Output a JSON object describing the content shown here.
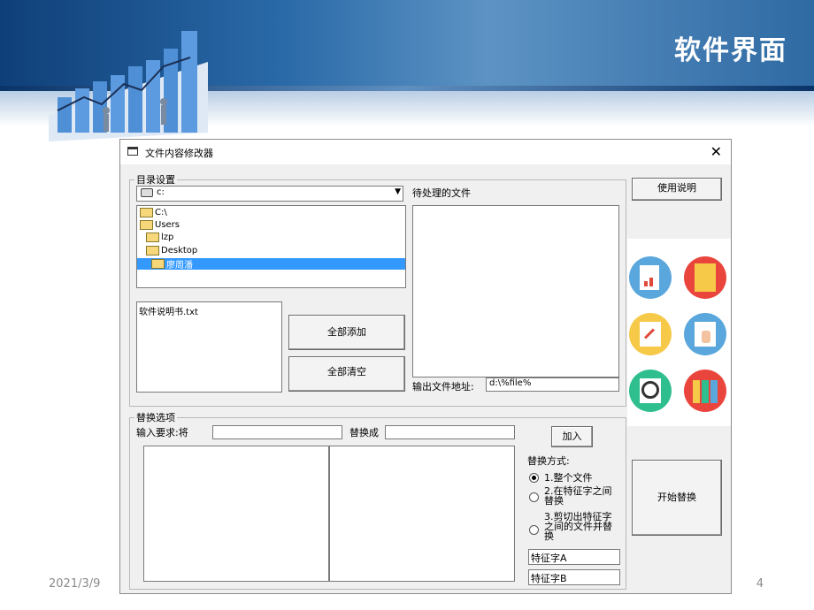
{
  "slide": {
    "title": "软件界面",
    "date": "2021/3/9",
    "page": "4"
  },
  "window": {
    "title": "文件内容修改器",
    "close_glyph": "✕"
  },
  "dir_settings": {
    "legend": "目录设置",
    "drive_value": "c:",
    "tree": [
      "C:\\",
      "Users",
      "lzp",
      "Desktop",
      "廖周潘"
    ],
    "selected_index": 4,
    "files": [
      "软件说明书.txt"
    ]
  },
  "pending": {
    "label": "待处理的文件",
    "output_label": "输出文件地址:",
    "output_value": "d:\\%file%"
  },
  "buttons": {
    "help": "使用说明",
    "add_all": "全部添加",
    "clear_all": "全部清空",
    "add": "加入",
    "start": "开始替换"
  },
  "replace": {
    "legend": "替换选项",
    "input_label": "输入要求:将",
    "replace_with": "替换成",
    "mode_label": "替换方式:",
    "modes": [
      "1.整个文件",
      "2.在特征字之间替换",
      "3.剪切出特征字之间的文件并替换"
    ],
    "selected_mode": 0,
    "marker_a": "特征字A",
    "marker_b": "特征字B"
  },
  "colors": {
    "banner": "#1f5a97",
    "selection": "#3399ff"
  }
}
